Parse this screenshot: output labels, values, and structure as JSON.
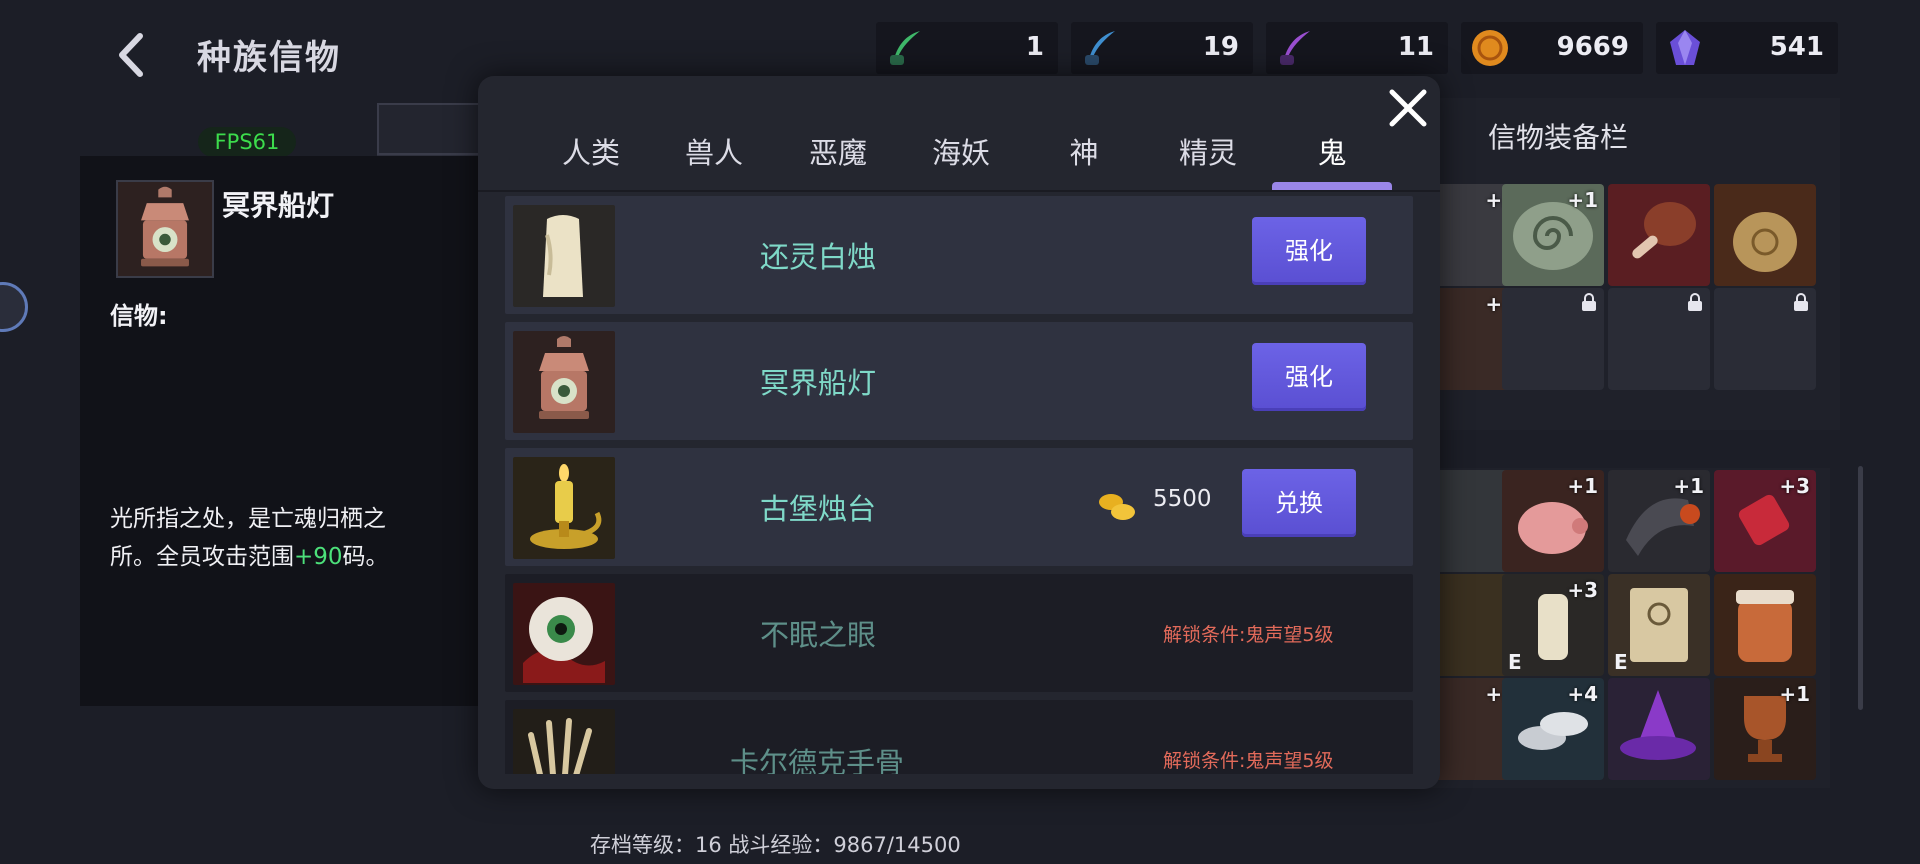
{
  "header": {
    "title": "种族信物"
  },
  "resources": [
    {
      "icon": "green-feather-quill-icon",
      "value": "1",
      "color": "#3fb86a"
    },
    {
      "icon": "blue-feather-quill-icon",
      "value": "19",
      "color": "#3f8fd0"
    },
    {
      "icon": "purple-feather-quill-icon",
      "value": "11",
      "color": "#9a4fd0"
    },
    {
      "icon": "gold-coin-icon",
      "value": "9669",
      "color": "#e08a1e"
    },
    {
      "icon": "purple-crystal-icon",
      "value": "541",
      "color": "#6a4fd8"
    }
  ],
  "fps": "FPS61",
  "detail": {
    "name": "冥界船灯",
    "label": "信物:",
    "desc_part1": "光所指之处，是亡魂归栖之所。全员攻击范围",
    "desc_highlight": "+90",
    "desc_part2": "码。"
  },
  "equipment": {
    "title": "信物装备栏"
  },
  "modal": {
    "tabs": [
      "人类",
      "兽人",
      "恶魔",
      "海妖",
      "神",
      "精灵",
      "鬼"
    ],
    "active_tab": "鬼",
    "items": [
      {
        "name": "还灵白烛",
        "icon": "white-candle-icon",
        "state": "owned",
        "button": "强化"
      },
      {
        "name": "冥界船灯",
        "icon": "ship-lantern-icon",
        "state": "owned",
        "button": "强化"
      },
      {
        "name": "古堡烛台",
        "icon": "candlestick-icon",
        "state": "exchange",
        "price": "5500",
        "button": "兑换"
      },
      {
        "name": "不眠之眼",
        "icon": "eyeball-icon",
        "state": "locked",
        "condition": "解锁条件:鬼声望5级"
      },
      {
        "name": "卡尔德克手骨",
        "icon": "bone-hand-icon",
        "state": "locked",
        "condition": "解锁条件:鬼声望5级"
      }
    ]
  },
  "footer": {
    "text": "存档等级：16 战斗经验：9867/14500"
  }
}
